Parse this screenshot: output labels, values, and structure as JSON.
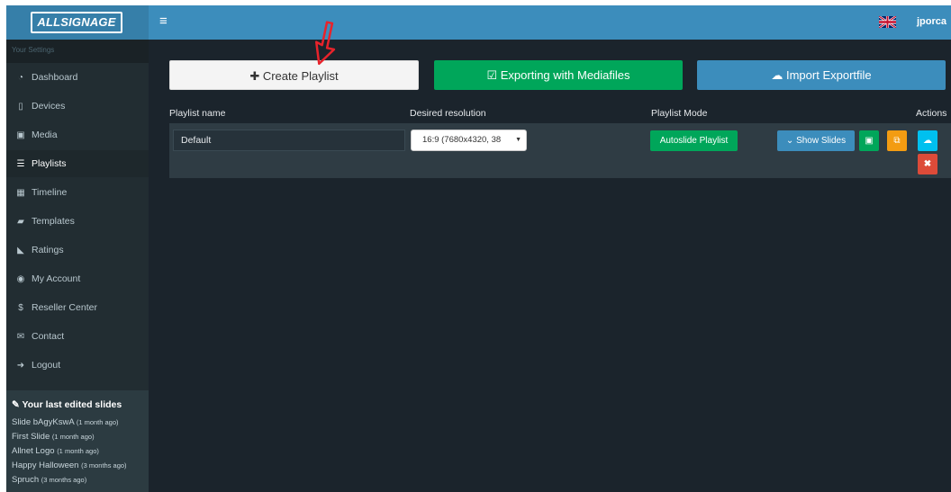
{
  "brand": {
    "logo_text": "ALLSIGNAGE"
  },
  "topbar": {
    "menu_icon": "≡",
    "flag_icon": "uk-flag-icon",
    "username": "jporca"
  },
  "sidebar": {
    "header": "Your Settings",
    "items": [
      {
        "label": "Dashboard",
        "icon": "dashboard-icon",
        "glyph": "◔"
      },
      {
        "label": "Devices",
        "icon": "tablet-icon",
        "glyph": "▯"
      },
      {
        "label": "Media",
        "icon": "image-icon",
        "glyph": "▣"
      },
      {
        "label": "Playlists",
        "icon": "list-icon",
        "glyph": "☰"
      },
      {
        "label": "Timeline",
        "icon": "calendar-icon",
        "glyph": "▦"
      },
      {
        "label": "Templates",
        "icon": "folder-icon",
        "glyph": "▰"
      },
      {
        "label": "Ratings",
        "icon": "area-chart-icon",
        "glyph": "◣"
      },
      {
        "label": "My Account",
        "icon": "user-circle-icon",
        "glyph": "◉"
      },
      {
        "label": "Reseller Center",
        "icon": "dollar-icon",
        "glyph": "$"
      },
      {
        "label": "Contact",
        "icon": "envelope-icon",
        "glyph": "✉"
      },
      {
        "label": "Logout",
        "icon": "sign-out-icon",
        "glyph": "➜"
      }
    ],
    "recent": {
      "title": "Your last edited slides",
      "icon": "edit-icon",
      "slides": [
        {
          "name": "Slide bAgyKswA",
          "ago": "(1 month ago)"
        },
        {
          "name": "First Slide",
          "ago": "(1 month ago)"
        },
        {
          "name": "Allnet Logo",
          "ago": "(1 month ago)"
        },
        {
          "name": "Happy Halloween",
          "ago": "(3 months ago)"
        },
        {
          "name": "Spruch",
          "ago": "(3 months ago)"
        }
      ]
    }
  },
  "toolbar": {
    "create_label": "Create Playlist",
    "export_label": "Exporting with Mediafiles",
    "import_label": "Import Exportfile"
  },
  "table": {
    "headers": {
      "name": "Playlist name",
      "resolution": "Desired resolution",
      "mode": "Playlist Mode",
      "actions": "Actions"
    },
    "rows": [
      {
        "name": "Default",
        "resolution": "16:9 (7680x4320, 38",
        "mode": "Autoslide Playlist",
        "show_slides": "Show Slides"
      }
    ]
  },
  "colors": {
    "topbar": "#3c8dbc",
    "sidebar": "#222d32",
    "content": "#1b242c",
    "success": "#00a65a",
    "primary": "#3c8dbc",
    "warning": "#f39c12",
    "info": "#00c0ef",
    "danger": "#dd4b39",
    "annotation_arrow": "#e8232b"
  }
}
